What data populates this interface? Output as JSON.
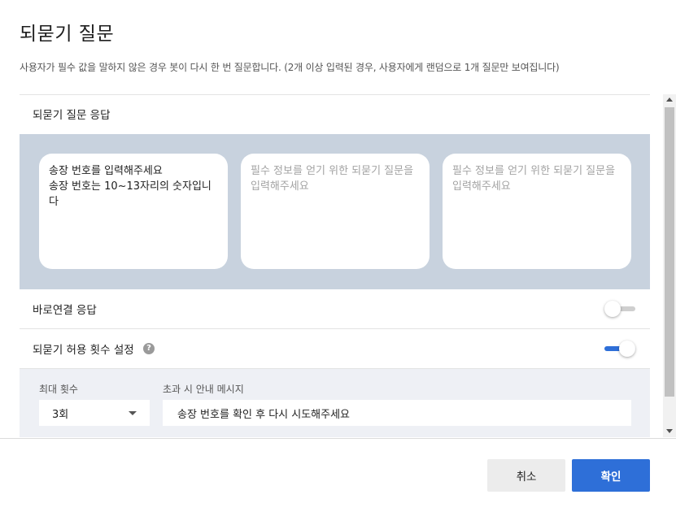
{
  "dialog": {
    "title": "되묻기 질문",
    "description": "사용자가 필수 값을 말하지 않은 경우 봇이 다시 한 번 질문합니다. (2개 이상 입력된 경우, 사용자에게 랜덤으로 1개 질문만 보여집니다)"
  },
  "reask_section": {
    "label": "되묻기 질문 응답",
    "cards": [
      {
        "text": "송장 번호를 입력해주세요\n송장 번호는 10~13자리의 숫자입니다",
        "is_placeholder": false
      },
      {
        "text": "필수 정보를 얻기 위한 되묻기 질문을 입력해주세요",
        "is_placeholder": true
      },
      {
        "text": "필수 정보를 얻기 위한 되묻기 질문을 입력해주세요",
        "is_placeholder": true
      }
    ]
  },
  "direct_response": {
    "label": "바로연결 응답",
    "toggle_on": false
  },
  "retry_limit": {
    "label": "되묻기 허용 횟수 설정",
    "help_icon": "question-circle-icon",
    "toggle_on": true,
    "max_count_label": "최대 횟수",
    "max_count_value": "3회",
    "exceed_message_label": "초과 시 안내 메시지",
    "exceed_message_value": "송장 번호를 확인 후 다시 시도해주세요"
  },
  "footer": {
    "cancel_label": "취소",
    "confirm_label": "확인"
  },
  "colors": {
    "accent": "#2e6fd8",
    "card_panel_bg": "#c8d2de",
    "limit_panel_bg": "#eef0f5"
  }
}
